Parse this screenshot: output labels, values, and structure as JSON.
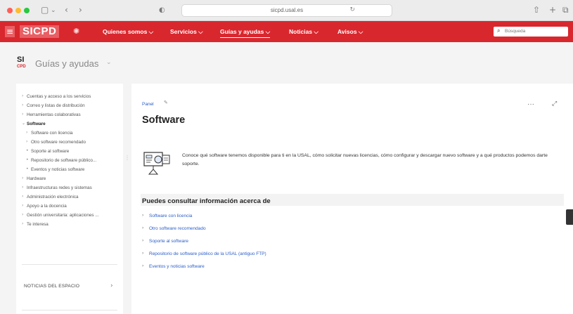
{
  "browser": {
    "url": "sicpd.usal.es",
    "icons": [
      "sidebar-icon",
      "back-icon",
      "forward-icon",
      "shield-icon",
      "lock-icon",
      "reload-icon",
      "share-icon",
      "new-tab-icon",
      "tabs-icon"
    ]
  },
  "nav": {
    "logo": "SICPD",
    "items": [
      {
        "label": "Quienes somos ⌵"
      },
      {
        "label": "Servicios ⌵"
      },
      {
        "label": "Guías y ayudas ⌵",
        "active": true
      },
      {
        "label": "Noticias ⌵"
      },
      {
        "label": "Avisos ⌵"
      }
    ],
    "search_placeholder": "Búsqueda"
  },
  "space": {
    "logo_top": "SI",
    "logo_bottom": "CPD",
    "title": "Guías y ayudas"
  },
  "sidebar": {
    "tree": [
      {
        "label": "Cuentas y acceso a los servicios",
        "level": 0,
        "arrow": "›"
      },
      {
        "label": "Correo y listas de distribución",
        "level": 0,
        "arrow": "›"
      },
      {
        "label": "Herramientas colaborativas",
        "level": 0,
        "arrow": "›"
      },
      {
        "label": "Software",
        "level": 0,
        "arrow": "⌄",
        "bold": true
      },
      {
        "label": "Software con licencia",
        "level": 1,
        "arrow": "›"
      },
      {
        "label": "Otro software recomendado",
        "level": 1,
        "arrow": "›"
      },
      {
        "label": "Soporte al software",
        "level": 1,
        "arrow": "•"
      },
      {
        "label": "Repositorio de software público...",
        "level": 1,
        "arrow": "•"
      },
      {
        "label": "Eventos y noticias software",
        "level": 1,
        "arrow": "•"
      },
      {
        "label": "Hardware",
        "level": 0,
        "arrow": "›"
      },
      {
        "label": "Infraestructuras redes y sistemas",
        "level": 0,
        "arrow": "›"
      },
      {
        "label": "Administración electrónica",
        "level": 0,
        "arrow": "›"
      },
      {
        "label": "Apoyo a la docencia",
        "level": 0,
        "arrow": "›"
      },
      {
        "label": "Gestión universitaria: aplicaciones ...",
        "level": 0,
        "arrow": "›"
      },
      {
        "label": "Te interesa",
        "level": 0,
        "arrow": "›"
      }
    ],
    "news_label": "NOTICIAS DEL ESPACIO"
  },
  "page": {
    "breadcrumb": "Panel",
    "title": "Software",
    "more": "···",
    "intro": "Conoce qué software tenemos disponible para ti en la USAL, cómo solicitar nuevas licencias, cómo configurar y descargar nuevo software y a qué productos podemos darte soporte.",
    "section_title": "Puedes consultar información acerca de",
    "links": [
      {
        "label": "Software con licencia"
      },
      {
        "label": "Otro software recomendado"
      },
      {
        "label": "Soporte al software"
      },
      {
        "label": "Repositorio de software público de la USAL (antiguo FTP)"
      },
      {
        "label": "Eventos y noticias software"
      }
    ]
  },
  "colors": {
    "brand_red": "#d9272e",
    "link_blue": "#2b5ec9"
  }
}
